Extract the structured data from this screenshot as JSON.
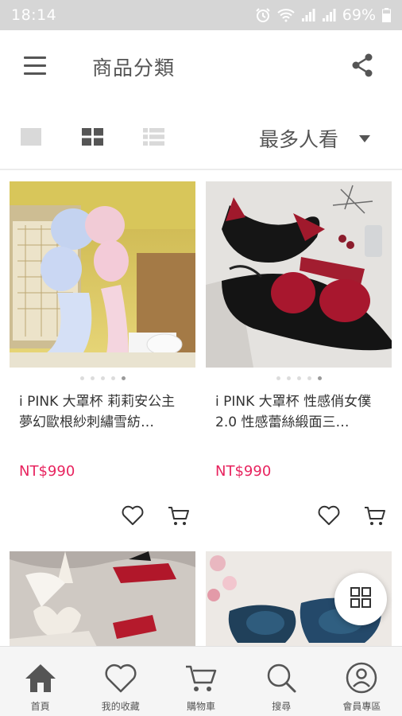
{
  "status_bar": {
    "time": "18:14",
    "battery": "69%"
  },
  "header": {
    "title": "商品分類"
  },
  "view_options": {
    "sort_label": "最多人看"
  },
  "products": [
    {
      "name": "i PINK 大罩杯 莉莉安公主 夢幻歐根紗刺繡雪紡…",
      "price": "NT$990",
      "active_dot": 4
    },
    {
      "name": "i PINK 大罩杯 性感俏女僕2.0 性感蕾絲緞面三…",
      "price": "NT$990",
      "active_dot": 4
    }
  ],
  "bottom_nav": [
    {
      "label": "首頁",
      "icon": "home-icon"
    },
    {
      "label": "我的收藏",
      "icon": "heart-icon"
    },
    {
      "label": "購物車",
      "icon": "cart-icon"
    },
    {
      "label": "搜尋",
      "icon": "search-icon"
    },
    {
      "label": "會員專區",
      "icon": "user-icon"
    }
  ],
  "colors": {
    "price": "#e8245f",
    "status_bar": "#d6d6d6",
    "icon": "#555555"
  }
}
